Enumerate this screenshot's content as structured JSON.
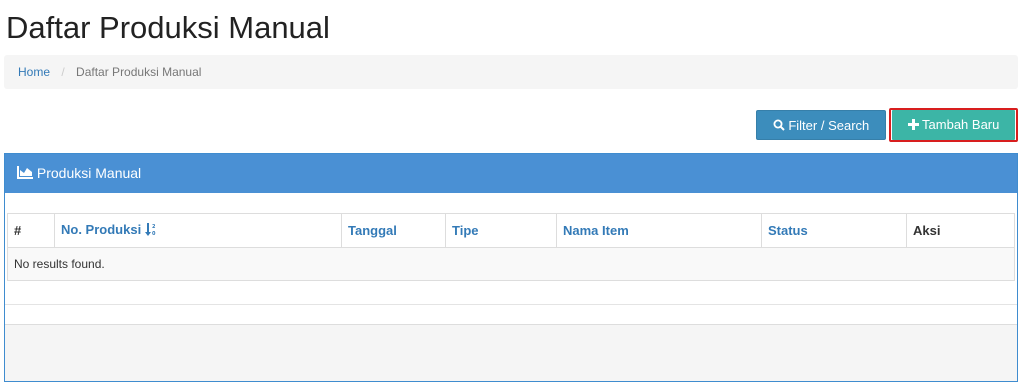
{
  "page": {
    "title": "Daftar Produksi Manual"
  },
  "breadcrumb": {
    "home": "Home",
    "separator": "/",
    "current": "Daftar Produksi Manual"
  },
  "toolbar": {
    "filter_label": "Filter / Search",
    "add_label": "Tambah Baru",
    "filter_icon": "search-icon",
    "add_icon": "plus-icon"
  },
  "panel": {
    "title": "Produksi Manual",
    "icon": "area-chart-icon",
    "color": "#4a90d4"
  },
  "table": {
    "columns": [
      "#",
      "No. Produksi",
      "Tanggal",
      "Tipe",
      "Nama Item",
      "Status",
      "Aksi"
    ],
    "sort_icon": "sort-numeric-asc-icon",
    "empty_message": "No results found."
  },
  "colors": {
    "primary": "#3c8dbc",
    "success": "#3cb5a6",
    "highlight": "#d81e1e"
  }
}
